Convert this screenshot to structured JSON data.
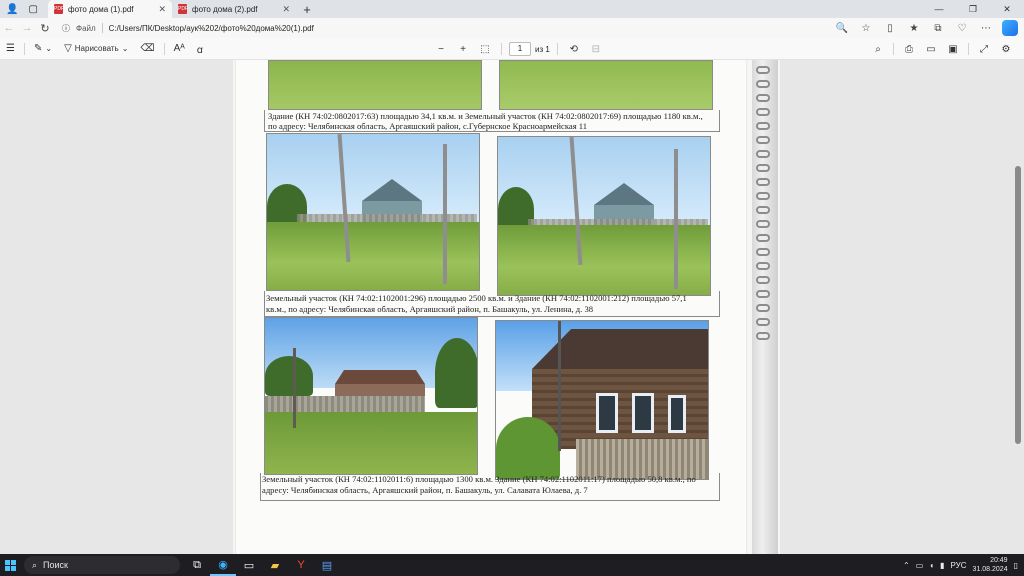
{
  "browser": {
    "tabs": [
      {
        "title": "фото дома (1).pdf",
        "active": true
      },
      {
        "title": "фото дома (2).pdf",
        "active": false
      }
    ],
    "new_tab": "+",
    "window_controls": {
      "minimize": "—",
      "restore": "❐",
      "close": "✕"
    }
  },
  "address": {
    "label": "Файл",
    "url": "C:/Users/ПК/Desktop/аук%202/фото%20дома%20(1).pdf"
  },
  "pdf_toolbar": {
    "draw_label": "Нарисовать",
    "page_current": "1",
    "page_total": "из 1"
  },
  "document": {
    "captions": [
      "Здание (КН 74:02:0802017:63) площадью 34,1 кв.м. и Земельный участок (КН 74:02:0802017:69) площадью 1180 кв.м.,",
      "по адресу: Челябинская область, Аргаяшский район, с.Губернское Красноармейская 11",
      "Земельный участок (КН 74:02:1102001:296) площадью 2500 кв.м. и Здание (КН 74:02:1102001:212) площадью 57,1",
      "кв.м., по адресу: Челябинская область, Аргаяшский район, п. Башакуль, ул. Ленина, д. 38",
      "Земельный участок (КН 74:02:1102011:6) площадью 1300 кв.м. Здание (КН 74:02:1102011:17) площадью 50,8 кв.м., по",
      "адресу: Челябинская область, Аргаяшский район, п. Башакуль, ул. Салавата Юлаева, д. 7"
    ]
  },
  "taskbar": {
    "search_placeholder": "Поиск",
    "language": "РУС",
    "time": "20:49",
    "date": "31.08.2024"
  }
}
